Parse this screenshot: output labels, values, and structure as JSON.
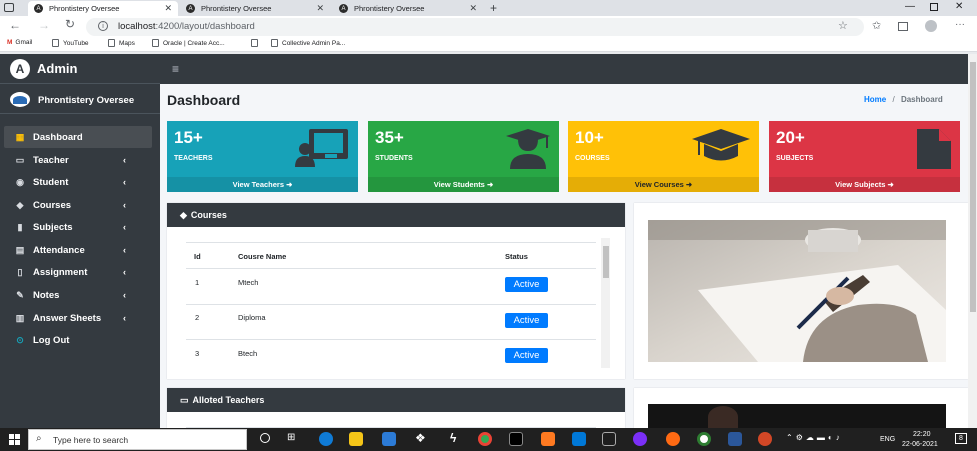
{
  "browser": {
    "tabs": [
      {
        "title": "Phrontistery Oversee"
      },
      {
        "title": "Phrontistery Oversee"
      },
      {
        "title": "Phrontistery Oversee"
      }
    ],
    "url_host": "localhost",
    "url_path": ":4200/layout/dashboard",
    "bookmarks": [
      "Gmail",
      "YouTube",
      "Maps",
      "Oracle | Create Acc...",
      "Collective Admin Pa..."
    ]
  },
  "sidebar": {
    "brand": "Admin",
    "user": "Phrontistery Oversee",
    "items": [
      {
        "label": "Dashboard",
        "icon": "grid-icon",
        "chevron": ""
      },
      {
        "label": "Teacher",
        "icon": "chalkboard-teacher-icon",
        "chevron": "‹"
      },
      {
        "label": "Student",
        "icon": "student-icon",
        "chevron": "‹"
      },
      {
        "label": "Courses",
        "icon": "graduation-cap-icon",
        "chevron": "‹"
      },
      {
        "label": "Subjects",
        "icon": "book-icon",
        "chevron": "‹"
      },
      {
        "label": "Attendance",
        "icon": "calendar-icon",
        "chevron": "‹"
      },
      {
        "label": "Assignment",
        "icon": "clipboard-icon",
        "chevron": "‹"
      },
      {
        "label": "Notes",
        "icon": "edit-icon",
        "chevron": "‹"
      },
      {
        "label": "Answer Sheets",
        "icon": "book-open-icon",
        "chevron": "‹"
      },
      {
        "label": "Log Out",
        "icon": "circle-icon",
        "chevron": ""
      }
    ]
  },
  "page": {
    "title": "Dashboard",
    "breadcrumb_home": "Home",
    "breadcrumb_sep": "/",
    "breadcrumb_current": "Dashboard"
  },
  "cards": [
    {
      "count": "15+",
      "label": "TEACHERS",
      "link": "View Teachers",
      "color": "#17a2b8",
      "foot": "#1591a5"
    },
    {
      "count": "35+",
      "label": "STUDENTS",
      "link": "View Students",
      "color": "#28a745",
      "foot": "#24963e"
    },
    {
      "count": "10+",
      "label": "COURSES",
      "link": "View Courses",
      "color": "#ffc107",
      "foot": "#e5ad06"
    },
    {
      "count": "20+",
      "label": "SUBJECTS",
      "link": "View Subjects",
      "color": "#dc3545",
      "foot": "#c6303e"
    }
  ],
  "courses": {
    "title": "Courses",
    "headers": [
      "Id",
      "Cousre Name",
      "Status"
    ],
    "rows": [
      {
        "id": "1",
        "name": "Mtech",
        "status": "Active"
      },
      {
        "id": "2",
        "name": "Diploma",
        "status": "Active"
      },
      {
        "id": "3",
        "name": "Btech",
        "status": "Active"
      }
    ]
  },
  "alloted": {
    "title": "Alloted Teachers"
  },
  "taskbar": {
    "search": "Type here to search",
    "lang": "ENG",
    "time": "22:20",
    "date": "22-06-2021",
    "notif": "8"
  }
}
